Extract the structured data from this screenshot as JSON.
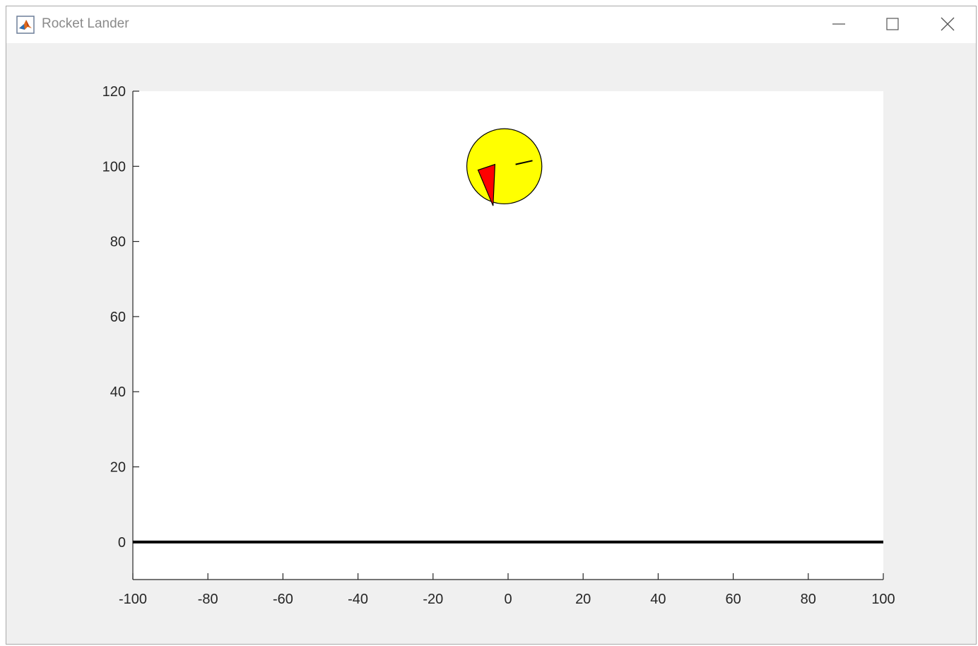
{
  "window": {
    "title": "Rocket Lander",
    "app_icon": "matlab-icon",
    "controls": {
      "minimize_icon": "minimize-icon",
      "maximize_icon": "maximize-icon",
      "close_icon": "close-icon"
    }
  },
  "chart_data": {
    "type": "scatter",
    "xlim": [
      -100,
      100
    ],
    "ylim": [
      -10,
      120
    ],
    "x_ticks": [
      -100,
      -80,
      -60,
      -40,
      -20,
      0,
      20,
      40,
      60,
      80,
      100
    ],
    "y_ticks": [
      0,
      20,
      40,
      60,
      80,
      100,
      120
    ],
    "x_tick_labels": [
      "-100",
      "-80",
      "-60",
      "-40",
      "-20",
      "0",
      "20",
      "40",
      "60",
      "80",
      "100"
    ],
    "y_tick_labels": [
      "0",
      "20",
      "40",
      "60",
      "80",
      "100",
      "120"
    ],
    "grid": false,
    "ground": {
      "y": 0,
      "x_from": -100,
      "x_to": 100,
      "color": "#000000"
    },
    "rocket": {
      "center": [
        -1,
        100
      ],
      "radius": 10,
      "body_color": "#ffff00",
      "flame_color": "#ff0000",
      "flame_vertices": [
        [
          -8,
          99
        ],
        [
          -3.5,
          100.5
        ],
        [
          -4,
          89.5
        ]
      ],
      "marker_segment": [
        [
          2,
          100.5
        ],
        [
          6.5,
          101.5
        ]
      ]
    }
  }
}
